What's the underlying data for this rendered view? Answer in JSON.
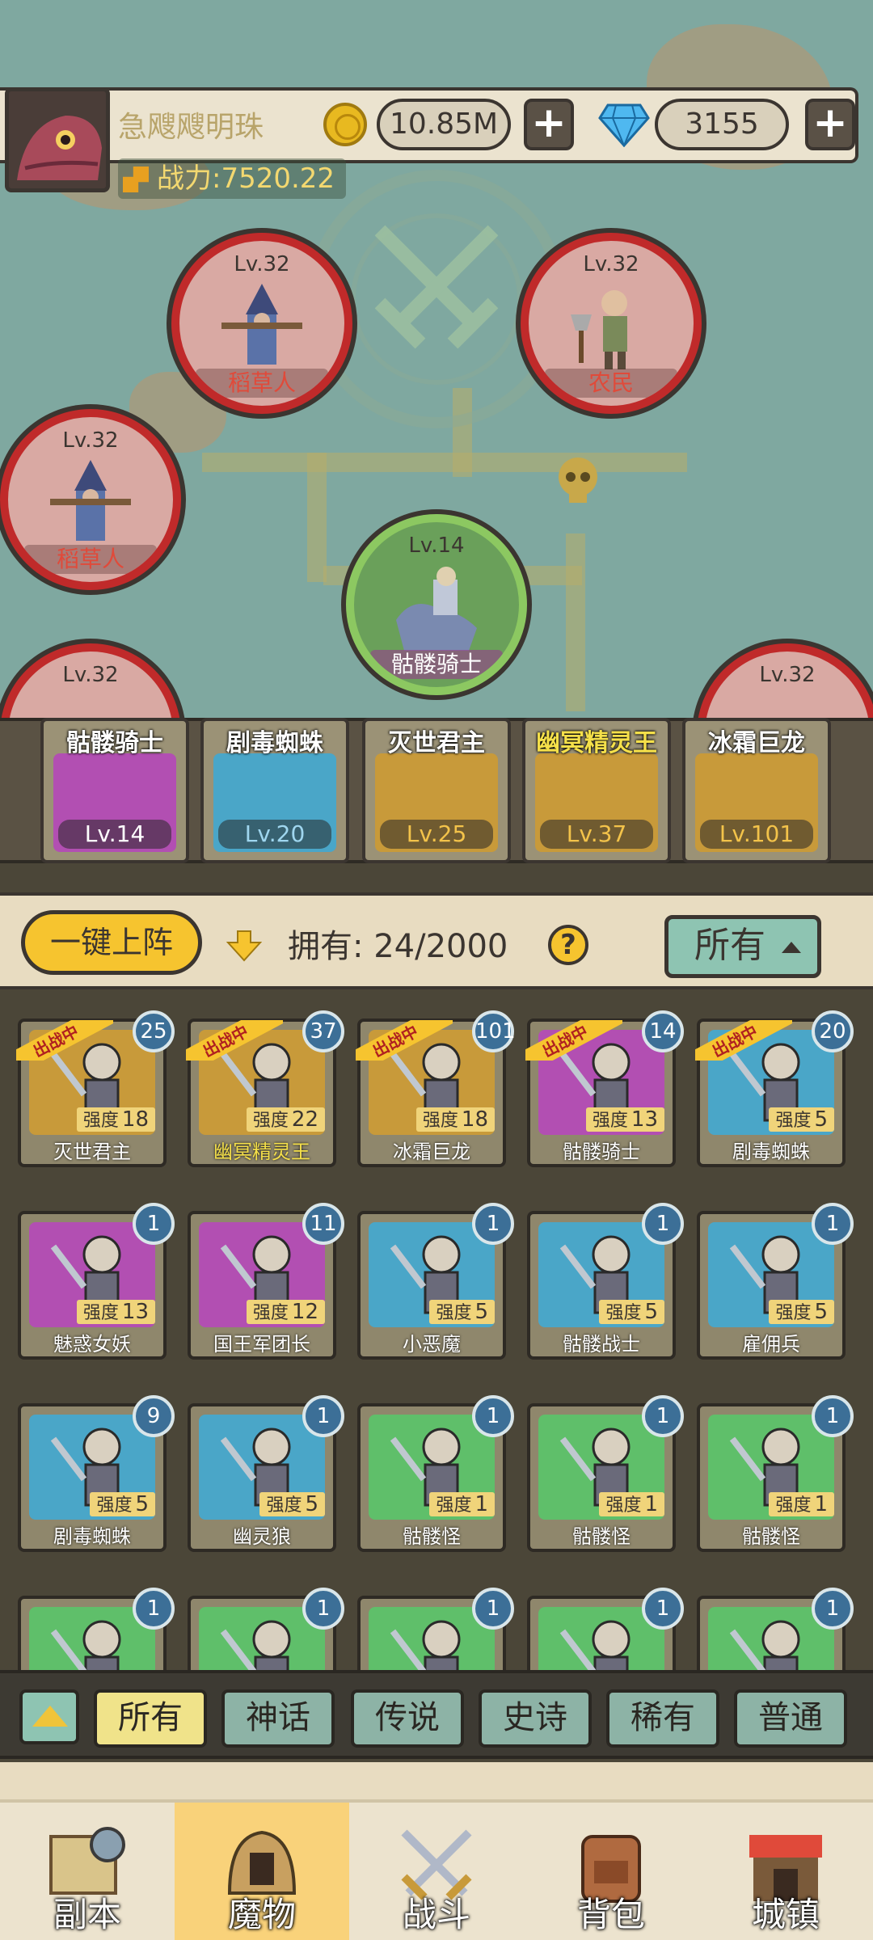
{
  "player": {
    "name": "急飕飕明珠",
    "power_label": "战力:7520.22",
    "gold": "10.85M",
    "gems": "3155"
  },
  "map_nodes": [
    {
      "level": "Lv.32",
      "name": "稻草人",
      "kind": "enemy"
    },
    {
      "level": "Lv.32",
      "name": "农民",
      "kind": "enemy"
    },
    {
      "level": "Lv.32",
      "name": "稻草人",
      "kind": "enemy"
    },
    {
      "level": "Lv.14",
      "name": "骷髅骑士",
      "kind": "ally"
    },
    {
      "level": "Lv.32",
      "name": "",
      "kind": "enemy"
    },
    {
      "level": "Lv.32",
      "name": "",
      "kind": "enemy"
    }
  ],
  "lineup": [
    {
      "name": "骷髅骑士",
      "level": "Lv.14",
      "color": "#b24fb2",
      "name_color": "#ffffff",
      "level_color": "#ffffff"
    },
    {
      "name": "剧毒蜘蛛",
      "level": "Lv.20",
      "color": "#4aa6c8",
      "name_color": "#ffffff",
      "level_color": "#9fd6ef"
    },
    {
      "name": "灭世君主",
      "level": "Lv.25",
      "color": "#c89a3a",
      "name_color": "#ffffff",
      "level_color": "#f3c34a"
    },
    {
      "name": "幽冥精灵王",
      "level": "Lv.37",
      "color": "#c89a3a",
      "name_color": "#f5e04a",
      "level_color": "#f3c34a"
    },
    {
      "name": "冰霜巨龙",
      "level": "Lv.101",
      "color": "#c89a3a",
      "name_color": "#ffffff",
      "level_color": "#f3c34a"
    }
  ],
  "roster": {
    "quick_deploy": "一键上阵",
    "owned_label": "拥有: 24/2000",
    "help": "?",
    "filter": "所有",
    "deployed_tag": "出战中",
    "strength_prefix": "强度",
    "monsters": [
      {
        "name": "灭世君主",
        "count": "25",
        "strength": "18",
        "bg": "#c89a3a",
        "deployed": true,
        "gold": false
      },
      {
        "name": "幽冥精灵王",
        "count": "37",
        "strength": "22",
        "bg": "#c89a3a",
        "deployed": true,
        "gold": true
      },
      {
        "name": "冰霜巨龙",
        "count": "101",
        "strength": "18",
        "bg": "#c89a3a",
        "deployed": true,
        "gold": false
      },
      {
        "name": "骷髅骑士",
        "count": "14",
        "strength": "13",
        "bg": "#b24fb2",
        "deployed": true,
        "gold": false
      },
      {
        "name": "剧毒蜘蛛",
        "count": "20",
        "strength": "5",
        "bg": "#4aa6c8",
        "deployed": true,
        "gold": false
      },
      {
        "name": "魅惑女妖",
        "count": "1",
        "strength": "13",
        "bg": "#b24fb2",
        "deployed": false,
        "gold": false
      },
      {
        "name": "国王军团长",
        "count": "11",
        "strength": "12",
        "bg": "#b24fb2",
        "deployed": false,
        "gold": false
      },
      {
        "name": "小恶魔",
        "count": "1",
        "strength": "5",
        "bg": "#4aa6c8",
        "deployed": false,
        "gold": false
      },
      {
        "name": "骷髅战士",
        "count": "1",
        "strength": "5",
        "bg": "#4aa6c8",
        "deployed": false,
        "gold": false
      },
      {
        "name": "雇佣兵",
        "count": "1",
        "strength": "5",
        "bg": "#4aa6c8",
        "deployed": false,
        "gold": false
      },
      {
        "name": "剧毒蜘蛛",
        "count": "9",
        "strength": "5",
        "bg": "#4aa6c8",
        "deployed": false,
        "gold": false
      },
      {
        "name": "幽灵狼",
        "count": "1",
        "strength": "5",
        "bg": "#4aa6c8",
        "deployed": false,
        "gold": false
      },
      {
        "name": "骷髅怪",
        "count": "1",
        "strength": "1",
        "bg": "#5fbf6a",
        "deployed": false,
        "gold": false
      },
      {
        "name": "骷髅怪",
        "count": "1",
        "strength": "1",
        "bg": "#5fbf6a",
        "deployed": false,
        "gold": false
      },
      {
        "name": "骷髅怪",
        "count": "1",
        "strength": "1",
        "bg": "#5fbf6a",
        "deployed": false,
        "gold": false
      },
      {
        "name": "",
        "count": "1",
        "strength": "",
        "bg": "#5fbf6a",
        "deployed": false,
        "gold": false
      },
      {
        "name": "",
        "count": "1",
        "strength": "",
        "bg": "#5fbf6a",
        "deployed": false,
        "gold": false
      },
      {
        "name": "",
        "count": "1",
        "strength": "",
        "bg": "#5fbf6a",
        "deployed": false,
        "gold": false
      },
      {
        "name": "",
        "count": "1",
        "strength": "",
        "bg": "#5fbf6a",
        "deployed": false,
        "gold": false
      },
      {
        "name": "",
        "count": "1",
        "strength": "",
        "bg": "#5fbf6a",
        "deployed": false,
        "gold": false
      }
    ]
  },
  "tiers": [
    "所有",
    "神话",
    "传说",
    "史诗",
    "稀有",
    "普通"
  ],
  "nav": [
    "副本",
    "魔物",
    "战斗",
    "背包",
    "城镇"
  ],
  "colors": {
    "accent": "#f6c42f",
    "enemy_ring": "#c02a2a",
    "ally_ring": "#8cc861",
    "badge": "#3c6f97"
  }
}
